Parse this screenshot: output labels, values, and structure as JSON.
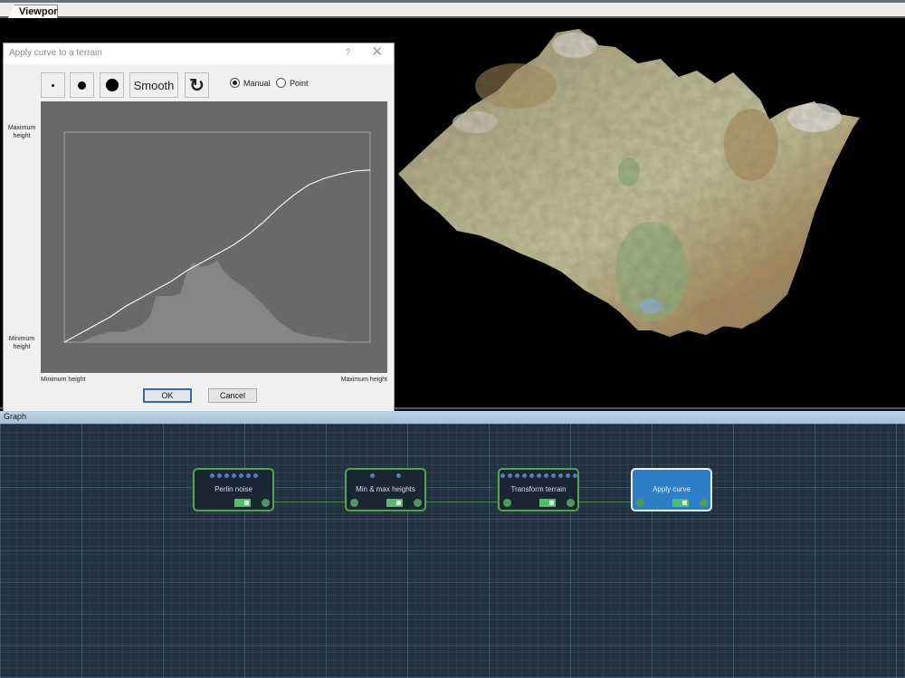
{
  "tabs": [
    {
      "label": "Viewport",
      "active": true
    }
  ],
  "dialog": {
    "title": "Apply curve to a terrain",
    "help_glyph": "?",
    "close_glyph": "✕",
    "toolbar": {
      "brush_small_icon": "small-dot",
      "brush_medium_icon": "medium-dot",
      "brush_large_icon": "large-dot",
      "smooth_label": "Smooth",
      "reset_icon": "↻"
    },
    "mode": {
      "options": [
        {
          "label": "Manual",
          "selected": true
        },
        {
          "label": "Point",
          "selected": false
        }
      ]
    },
    "y_max_label": [
      "Maximum",
      "height"
    ],
    "y_min_label": [
      "Minimum",
      "height"
    ],
    "x_min_label": "Minimum height",
    "x_max_label": "Maximum height",
    "ok_label": "OK",
    "cancel_label": "Cancel"
  },
  "chart_data": {
    "type": "line",
    "title": "Apply curve to a terrain",
    "xlabel_min": "Minimum height",
    "xlabel_max": "Maximum height",
    "ylabel_min": "Minimum height",
    "ylabel_max": "Maximum height",
    "xlim": [
      0,
      1
    ],
    "ylim": [
      0,
      1
    ],
    "grid": false,
    "series": [
      {
        "name": "curve",
        "x": [
          0,
          0.05,
          0.1,
          0.15,
          0.2,
          0.25,
          0.3,
          0.35,
          0.4,
          0.45,
          0.5,
          0.55,
          0.6,
          0.65,
          0.7,
          0.75,
          0.8,
          0.85,
          0.9,
          0.95,
          1.0
        ],
        "y": [
          0,
          0.04,
          0.08,
          0.12,
          0.17,
          0.21,
          0.25,
          0.29,
          0.34,
          0.38,
          0.42,
          0.46,
          0.51,
          0.57,
          0.64,
          0.7,
          0.75,
          0.78,
          0.8,
          0.815,
          0.82
        ]
      },
      {
        "name": "height-histogram",
        "type": "area",
        "x": [
          0,
          0.05,
          0.1,
          0.15,
          0.2,
          0.25,
          0.28,
          0.3,
          0.35,
          0.38,
          0.4,
          0.42,
          0.45,
          0.48,
          0.5,
          0.52,
          0.55,
          0.58,
          0.6,
          0.65,
          0.7,
          0.75,
          0.8,
          0.85,
          0.9,
          0.95,
          1.0
        ],
        "y": [
          0,
          0.0,
          0.03,
          0.05,
          0.05,
          0.08,
          0.12,
          0.22,
          0.22,
          0.23,
          0.33,
          0.38,
          0.36,
          0.37,
          0.39,
          0.34,
          0.3,
          0.27,
          0.25,
          0.18,
          0.1,
          0.05,
          0.03,
          0.02,
          0.01,
          0.0,
          0
        ]
      }
    ]
  },
  "graph": {
    "header_label": "Graph",
    "nodes": [
      {
        "title": "Perlin noise",
        "input_ports": 7,
        "has_left_port": false,
        "enabled": true,
        "selected": false
      },
      {
        "title": "Min & max heights",
        "input_ports": 2,
        "has_left_port": true,
        "enabled": true,
        "selected": false
      },
      {
        "title": "Transform terrain",
        "input_ports": 11,
        "has_left_port": true,
        "enabled": true,
        "selected": false
      },
      {
        "title": "Apply curve",
        "input_ports": 0,
        "has_left_port": true,
        "enabled": true,
        "selected": true
      }
    ],
    "colors": {
      "node_border": "#56a34f",
      "selected_node": "#2f7fc8",
      "port_in": "#5679c8",
      "port_out": "#4c9b5a"
    }
  }
}
